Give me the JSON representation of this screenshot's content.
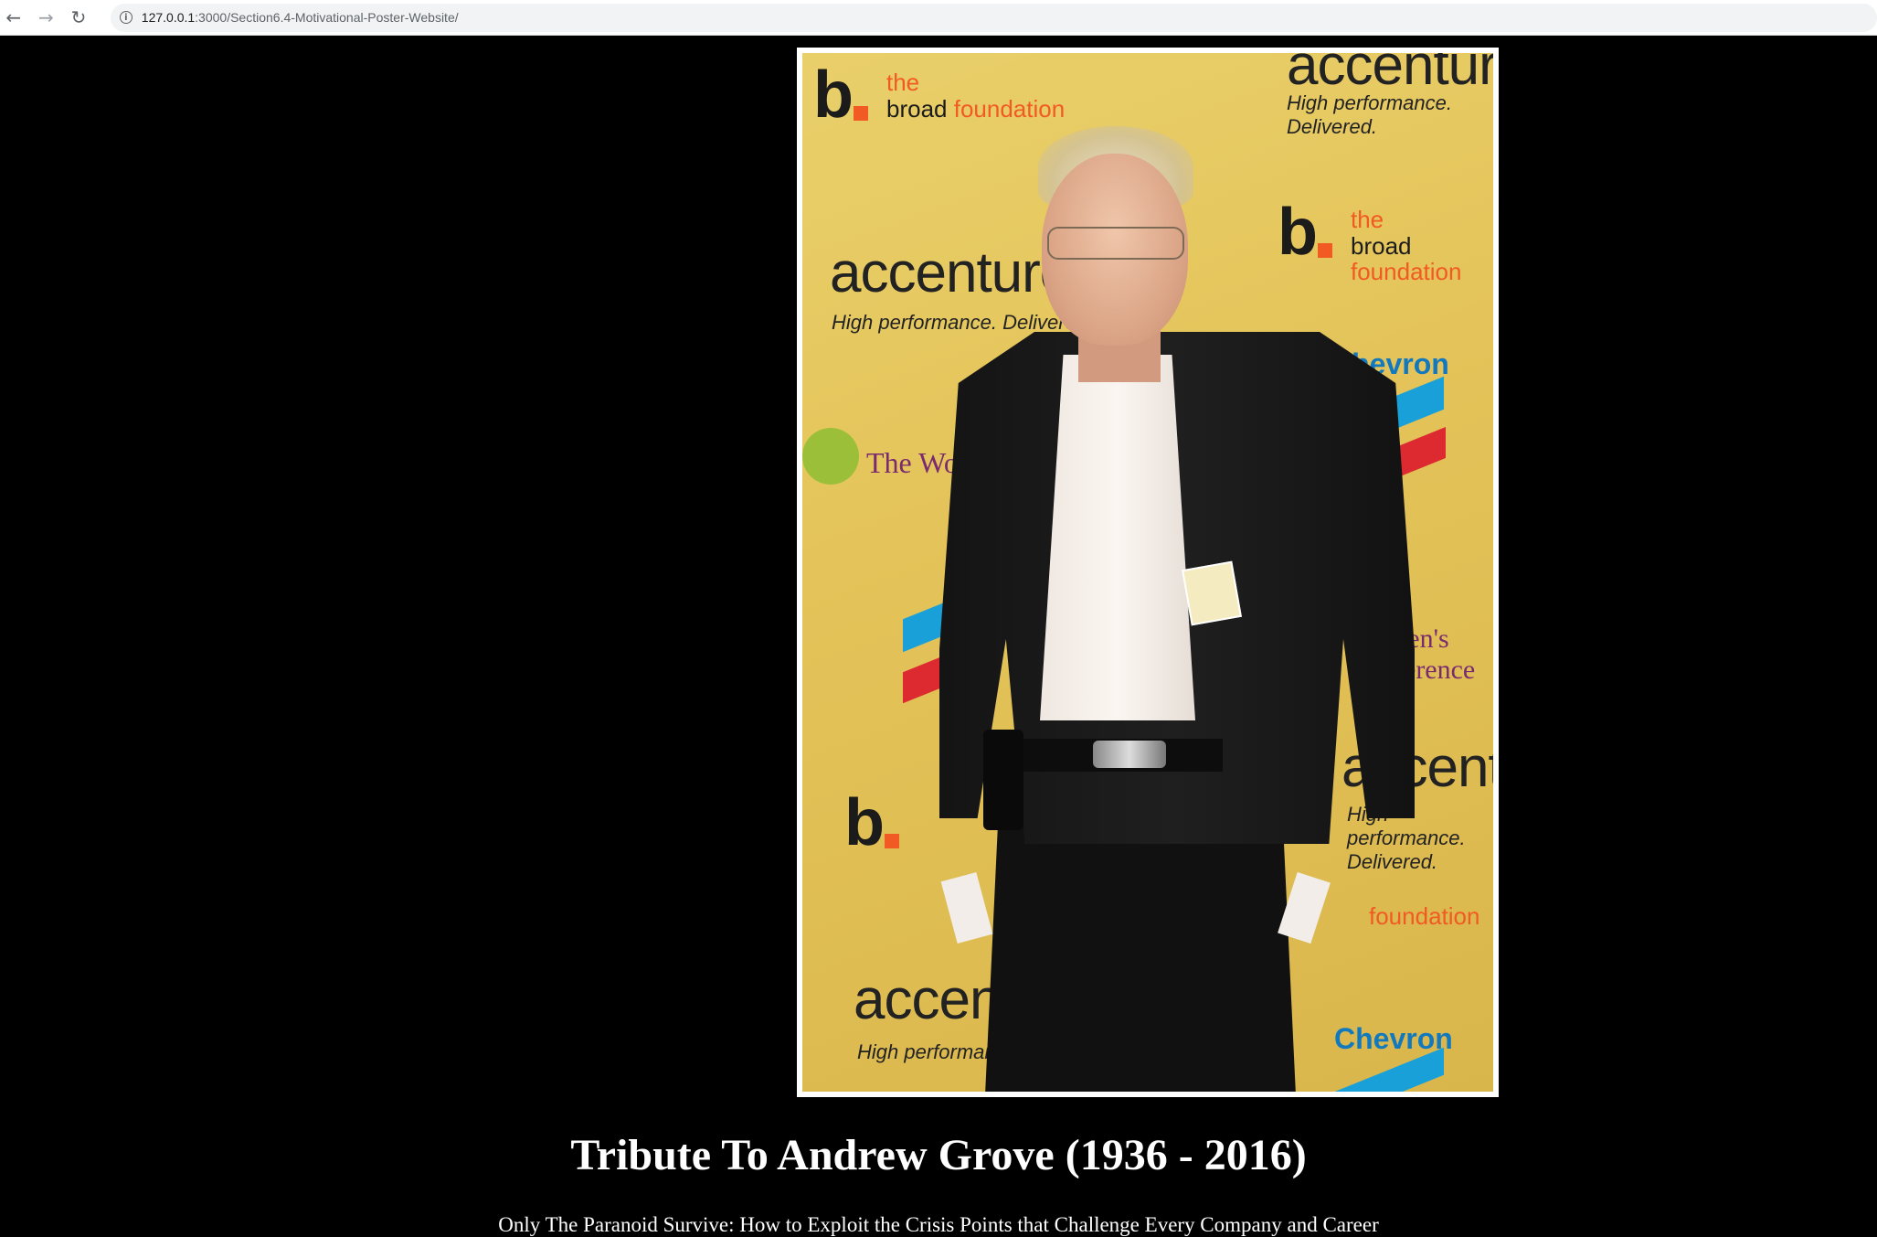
{
  "browser": {
    "url_host": "127.0.0.1",
    "url_path": ":3000/Section6.4-Motivational-Poster-Website/"
  },
  "poster": {
    "logos": {
      "broad_the": "the",
      "broad_word": "broad",
      "foundation_word": "foundation",
      "accenture": "accenture",
      "accenture_tag": "High performance. Delivered.",
      "chevron": "Chevron",
      "womens": "The Women's Conference"
    }
  },
  "page": {
    "title": "Tribute To Andrew Grove (1936 - 2016)",
    "subtitle": "Only The Paranoid Survive: How to Exploit the Crisis Points that Challenge Every Company and Career"
  },
  "icons": {
    "back": "arrow-left-icon",
    "forward": "arrow-right-icon",
    "reload": "reload-icon",
    "info": "info-icon"
  }
}
